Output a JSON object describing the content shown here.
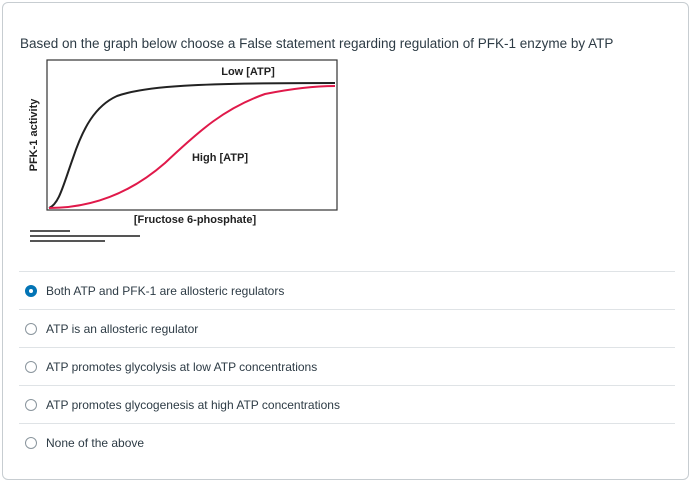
{
  "question": {
    "text": "Based on the graph below choose a False statement regarding regulation of PFK-1 enzyme  by ATP"
  },
  "figure": {
    "y_axis_label": "PFK-1 activity",
    "x_axis_label": "[Fructose 6-phosphate]",
    "low_atp_label": "Low [ATP]",
    "high_atp_label": "High [ATP]",
    "low_atp_color": "#222222",
    "high_atp_color": "#e0194a"
  },
  "answers": [
    {
      "label": "Both ATP and PFK-1 are allosteric regulators",
      "selected": true
    },
    {
      "label": "ATP is an allosteric regulator",
      "selected": false
    },
    {
      "label": "ATP promotes glycolysis at low ATP concentrations",
      "selected": false
    },
    {
      "label": "ATP promotes glycogenesis at high ATP concentrations",
      "selected": false
    },
    {
      "label": "None of the above",
      "selected": false
    }
  ],
  "accent_color": "#0374b5"
}
